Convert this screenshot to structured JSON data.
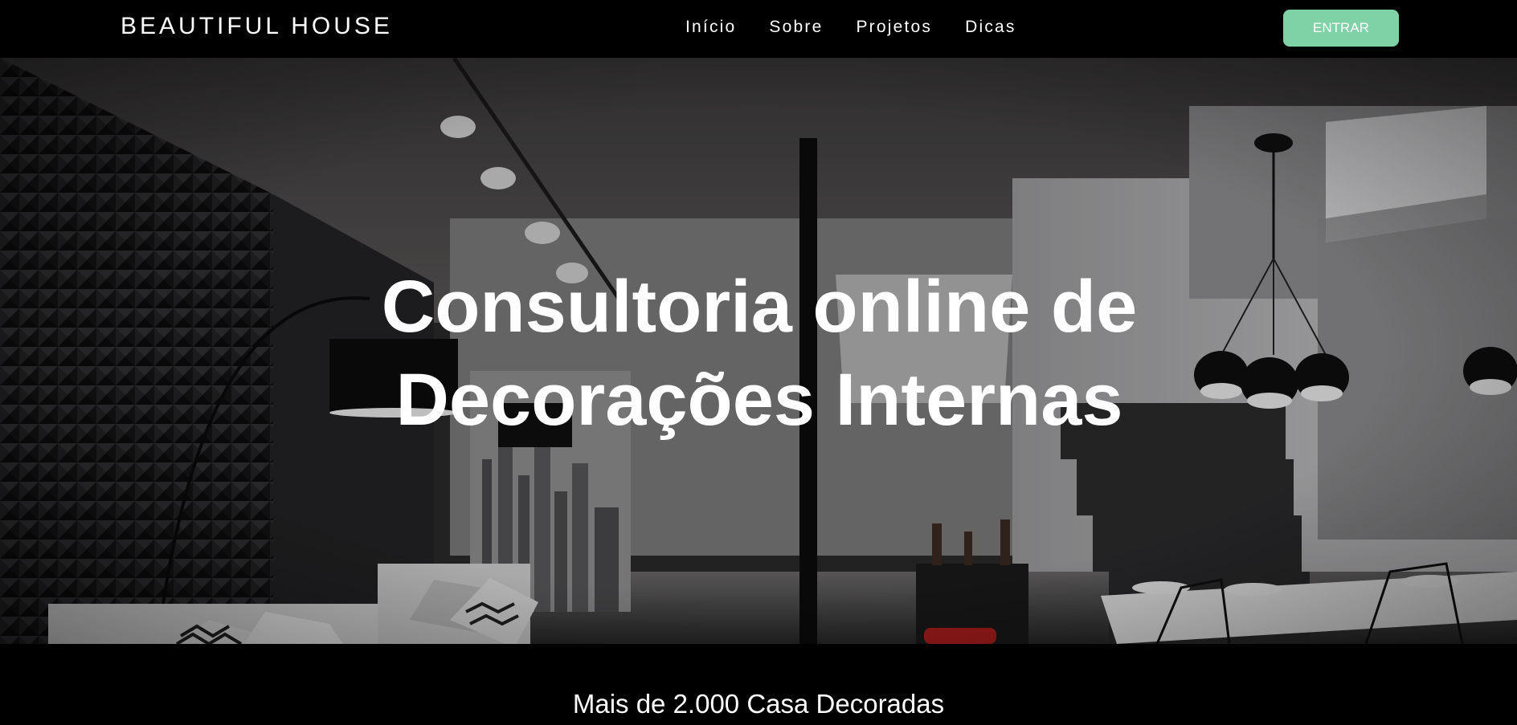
{
  "header": {
    "brand": "BEAUTIFUL HOUSE",
    "nav": [
      {
        "label": "Início"
      },
      {
        "label": "Sobre"
      },
      {
        "label": "Projetos"
      },
      {
        "label": "Dicas"
      }
    ],
    "login_label": "ENTRAR"
  },
  "hero": {
    "title_line1": "Consultoria online de",
    "title_line2": "Decorações Internas"
  },
  "stats": {
    "text": "Mais de 2.000 Casa Decoradas"
  },
  "colors": {
    "accent": "#7fd1a6",
    "background": "#000000"
  },
  "icons": [
    "interior-photo"
  ]
}
